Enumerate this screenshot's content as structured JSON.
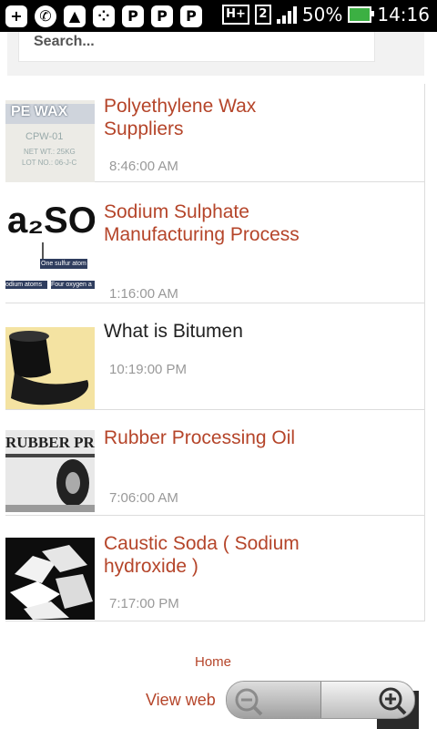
{
  "status_bar": {
    "icons": [
      "plus-icon",
      "whatsapp-icon",
      "gallery-icon",
      "bbm-icon",
      "pinterest-icon",
      "pinterest-icon",
      "pinterest-icon"
    ],
    "network": "H+",
    "sim": "2",
    "battery": "50%",
    "time": "14:16"
  },
  "search": {
    "placeholder": "Search..."
  },
  "posts": [
    {
      "title": "Polyethylene Wax Suppliers",
      "time": "8:46:00 AM",
      "thumb": "PE WAX",
      "thumb_lines": [
        "CPW-01",
        "NET WT.: 25KG",
        "LOT NO.: 06-J-C"
      ]
    },
    {
      "title": "Sodium Sulphate Manufacturing Process",
      "time": "1:16:00 AM",
      "thumb": "a₂SO",
      "thumb_lines": [
        "One sulfur atom",
        "odium atoms",
        "Four oxygen a"
      ]
    },
    {
      "title": "What is Bitumen",
      "time": "10:19:00 PM",
      "thumb": ""
    },
    {
      "title": "Rubber Processing Oil",
      "time": "7:06:00 AM",
      "thumb": "RUBBER PRO"
    },
    {
      "title": "Caustic Soda ( Sodium hydroxide )",
      "time": "7:17:00 PM",
      "thumb": ""
    }
  ],
  "footer": {
    "home": "Home",
    "view_web": "View web"
  },
  "colors": {
    "accent": "#b5452a",
    "time_text": "#999999"
  }
}
